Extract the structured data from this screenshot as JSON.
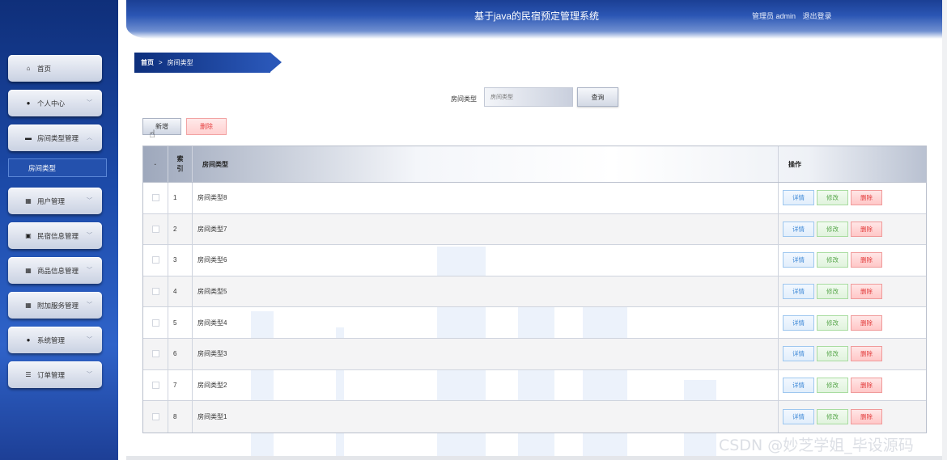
{
  "app": {
    "title": "基于java的民宿预定管理系统"
  },
  "header": {
    "user_label": "管理员 admin",
    "logout": "退出登录"
  },
  "sidebar": {
    "items": [
      {
        "label": "首页",
        "icon": "home-icon",
        "glyph": "⌂",
        "chevron": false
      },
      {
        "label": "个人中心",
        "icon": "user-icon",
        "glyph": "●",
        "chevron": true
      },
      {
        "label": "房间类型管理",
        "icon": "hotel-icon",
        "glyph": "▬",
        "chevron": true,
        "expanded": true
      },
      {
        "label": "用户管理",
        "icon": "grid-icon",
        "glyph": "▦",
        "chevron": true
      },
      {
        "label": "民宿信息管理",
        "icon": "building-icon",
        "glyph": "▣",
        "chevron": true
      },
      {
        "label": "商品信息管理",
        "icon": "grid-icon",
        "glyph": "▦",
        "chevron": true
      },
      {
        "label": "附加服务管理",
        "icon": "grid-icon",
        "glyph": "▦",
        "chevron": true
      },
      {
        "label": "系统管理",
        "icon": "user-icon",
        "glyph": "●",
        "chevron": true
      },
      {
        "label": "订单管理",
        "icon": "list-icon",
        "glyph": "☰",
        "chevron": true
      }
    ],
    "submenu_active": "房间类型"
  },
  "breadcrumb": {
    "home": "首页",
    "separator": ">",
    "current": "房间类型"
  },
  "search": {
    "label": "房间类型",
    "placeholder": "房间类型",
    "button": "查询"
  },
  "toolbar": {
    "add": "新增",
    "delete": "删除"
  },
  "table": {
    "headers": {
      "select": "",
      "index": "索引",
      "name": "房间类型",
      "ops": "操作"
    },
    "rows": [
      {
        "index": "1",
        "name": "房间类型8"
      },
      {
        "index": "2",
        "name": "房间类型7"
      },
      {
        "index": "3",
        "name": "房间类型6"
      },
      {
        "index": "4",
        "name": "房间类型5"
      },
      {
        "index": "5",
        "name": "房间类型4"
      },
      {
        "index": "6",
        "name": "房间类型3"
      },
      {
        "index": "7",
        "name": "房间类型2"
      },
      {
        "index": "8",
        "name": "房间类型1"
      }
    ],
    "ops": {
      "detail": "详情",
      "edit": "修改",
      "delete": "删除"
    }
  },
  "watermark": "CSDN @妙芝学姐_毕设源码",
  "colors": {
    "primary": "#1c4aa8",
    "detail": "#3a86d6",
    "edit": "#5aa84e",
    "danger": "#e23b3b"
  }
}
